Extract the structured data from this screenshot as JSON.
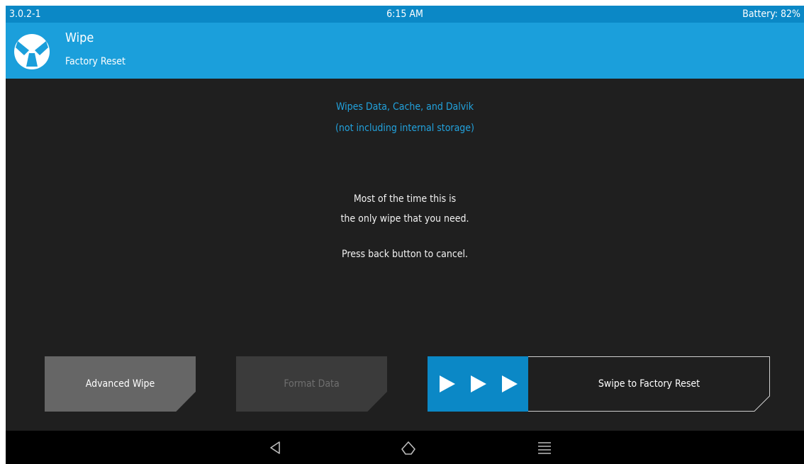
{
  "status_bar": {
    "version": "3.0.2-1",
    "time": "6:15 AM",
    "battery": "Battery: 82%"
  },
  "header": {
    "title": "Wipe",
    "subtitle": "Factory Reset",
    "logo_icon": "twrp-logo-icon"
  },
  "info": {
    "line1": "Wipes Data, Cache, and Dalvik",
    "line2": "(not including internal storage)",
    "line3": "Most of the time this is",
    "line4": "the only wipe that you need.",
    "line5": "Press back button to cancel."
  },
  "buttons": {
    "advanced_wipe": "Advanced Wipe",
    "format_data": "Format Data"
  },
  "swipe": {
    "label": "Swipe to Factory Reset",
    "arrow_icon": "play-arrow-icon"
  },
  "nav": {
    "back_icon": "back-triangle-icon",
    "home_icon": "home-icon",
    "menu_icon": "menu-lines-icon"
  },
  "colors": {
    "status_bar": "#0b88c6",
    "header": "#1b9fdb",
    "background": "#1f1f1f",
    "accent_text": "#22a2dd",
    "button_active": "#666666",
    "button_disabled": "#3b3b3b",
    "swipe_handle": "#0b88c6"
  }
}
